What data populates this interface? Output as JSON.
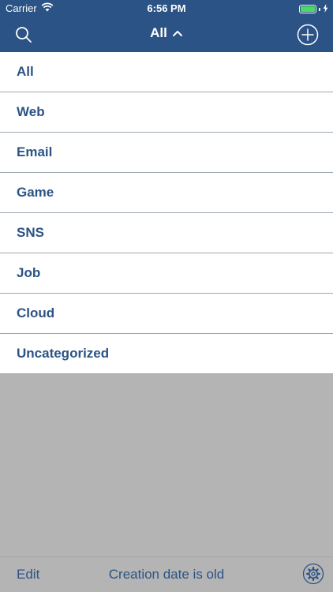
{
  "status_bar": {
    "carrier": "Carrier",
    "time": "6:56 PM",
    "wifi_icon": "wifi-icon",
    "battery_icon": "battery-icon",
    "charging_icon": "bolt-icon"
  },
  "nav": {
    "title": "All",
    "search_icon": "search-icon",
    "chevron_icon": "chevron-up-icon",
    "add_icon": "add-circle-icon"
  },
  "categories": [
    {
      "label": "All"
    },
    {
      "label": "Web"
    },
    {
      "label": "Email"
    },
    {
      "label": "Game"
    },
    {
      "label": "SNS"
    },
    {
      "label": "Job"
    },
    {
      "label": "Cloud"
    },
    {
      "label": "Uncategorized"
    }
  ],
  "toolbar": {
    "edit_label": "Edit",
    "sort_label": "Creation date is old",
    "settings_icon": "gear-icon"
  },
  "colors": {
    "brand": "#2b5385",
    "battery": "#4cd964",
    "background": "#b4b4b4"
  }
}
